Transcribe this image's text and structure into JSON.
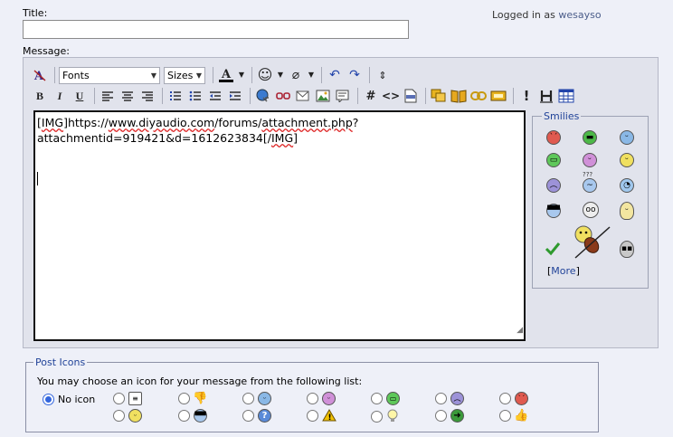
{
  "title_label": "Title:",
  "title_value": "",
  "logged_in": {
    "prefix": "Logged in as",
    "username": "wesayso"
  },
  "message_label": "Message:",
  "toolbar": {
    "fonts_select": "Fonts",
    "sizes_select": "Sizes",
    "bold": "B",
    "italic": "I",
    "underline": "U",
    "hash": "#",
    "code": "<>"
  },
  "message": {
    "line1_pre": "[",
    "line1_img": "IMG",
    "line1_mid1": "]https://",
    "line1_host": "www.diyaudio.com",
    "line1_mid2": "/forums/",
    "line1_file": "attachment.php",
    "line1_post": "?",
    "line2": "attachmentid=919421&d=1612623834[/",
    "line2_img": "IMG",
    "line2_end": "]"
  },
  "smilies": {
    "legend": "Smilies",
    "more_open": "[",
    "more_label": "More",
    "more_close": "]",
    "confused_marks": "???"
  },
  "post_icons": {
    "legend": "Post Icons",
    "description": "You may choose an icon for your message from the following list:",
    "no_icon_label": "No icon"
  },
  "colors": {
    "link_blue": "#224499",
    "panel_bg": "#e1e3ec",
    "page_bg": "#eef0f8"
  }
}
